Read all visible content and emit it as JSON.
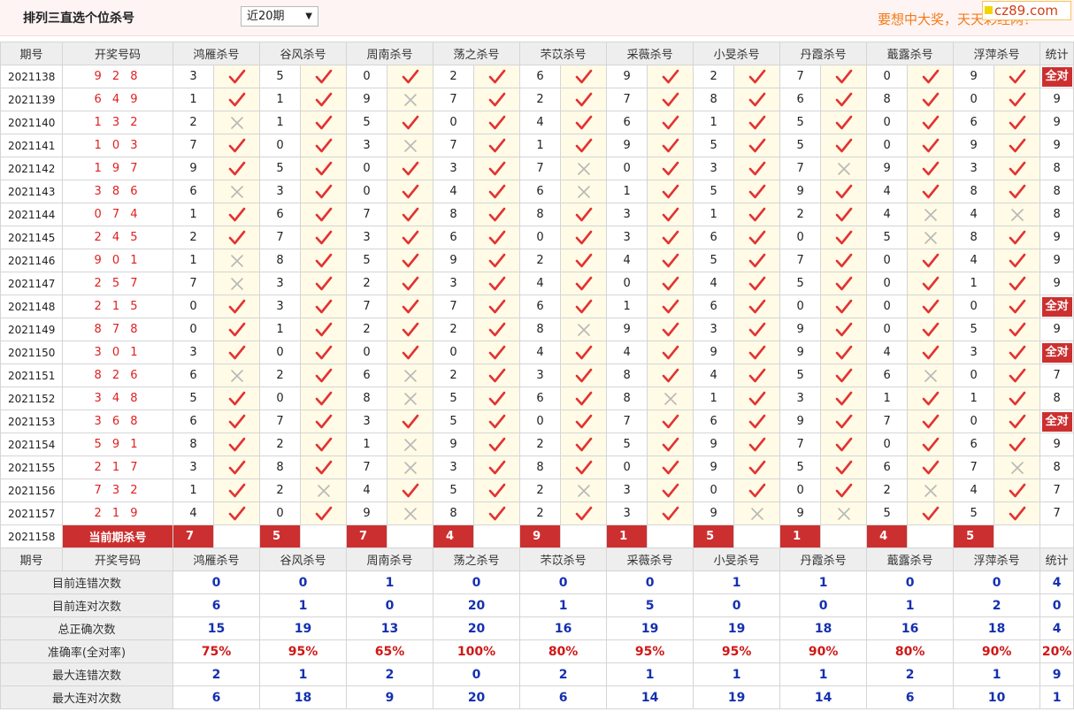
{
  "title": "排列三直选个位杀号",
  "period_selector": "近20期",
  "slogan": "要想中大奖，天天彩经网！",
  "logo": "cz89.com",
  "columns": {
    "period": "期号",
    "draw": "开奖号码",
    "experts": [
      "鸿雁杀号",
      "谷风杀号",
      "周南杀号",
      "荡之杀号",
      "芣苡杀号",
      "采薇杀号",
      "小旻杀号",
      "丹霞杀号",
      "蕺露杀号",
      "浮萍杀号"
    ],
    "stat": "统计"
  },
  "all_correct_label": "全对",
  "rows": [
    {
      "period": "2021138",
      "draw": "9 2 8",
      "kills": [
        [
          3,
          1
        ],
        [
          5,
          1
        ],
        [
          0,
          1
        ],
        [
          2,
          1
        ],
        [
          6,
          1
        ],
        [
          9,
          1
        ],
        [
          2,
          1
        ],
        [
          7,
          1
        ],
        [
          0,
          1
        ],
        [
          9,
          1
        ]
      ],
      "stat": "全对"
    },
    {
      "period": "2021139",
      "draw": "6 4 9",
      "kills": [
        [
          1,
          1
        ],
        [
          1,
          1
        ],
        [
          9,
          0
        ],
        [
          7,
          1
        ],
        [
          2,
          1
        ],
        [
          7,
          1
        ],
        [
          8,
          1
        ],
        [
          6,
          1
        ],
        [
          8,
          1
        ],
        [
          0,
          1
        ]
      ],
      "stat": "9"
    },
    {
      "period": "2021140",
      "draw": "1 3 2",
      "kills": [
        [
          2,
          0
        ],
        [
          1,
          1
        ],
        [
          5,
          1
        ],
        [
          0,
          1
        ],
        [
          4,
          1
        ],
        [
          6,
          1
        ],
        [
          1,
          1
        ],
        [
          5,
          1
        ],
        [
          0,
          1
        ],
        [
          6,
          1
        ]
      ],
      "stat": "9"
    },
    {
      "period": "2021141",
      "draw": "1 0 3",
      "kills": [
        [
          7,
          1
        ],
        [
          0,
          1
        ],
        [
          3,
          0
        ],
        [
          7,
          1
        ],
        [
          1,
          1
        ],
        [
          9,
          1
        ],
        [
          5,
          1
        ],
        [
          5,
          1
        ],
        [
          0,
          1
        ],
        [
          9,
          1
        ]
      ],
      "stat": "9"
    },
    {
      "period": "2021142",
      "draw": "1 9 7",
      "kills": [
        [
          9,
          1
        ],
        [
          5,
          1
        ],
        [
          0,
          1
        ],
        [
          3,
          1
        ],
        [
          7,
          0
        ],
        [
          0,
          1
        ],
        [
          3,
          1
        ],
        [
          7,
          0
        ],
        [
          9,
          1
        ],
        [
          3,
          1
        ]
      ],
      "stat": "8"
    },
    {
      "period": "2021143",
      "draw": "3 8 6",
      "kills": [
        [
          6,
          0
        ],
        [
          3,
          1
        ],
        [
          0,
          1
        ],
        [
          4,
          1
        ],
        [
          6,
          0
        ],
        [
          1,
          1
        ],
        [
          5,
          1
        ],
        [
          9,
          1
        ],
        [
          4,
          1
        ],
        [
          8,
          1
        ]
      ],
      "stat": "8"
    },
    {
      "period": "2021144",
      "draw": "0 7 4",
      "kills": [
        [
          1,
          1
        ],
        [
          6,
          1
        ],
        [
          7,
          1
        ],
        [
          8,
          1
        ],
        [
          8,
          1
        ],
        [
          3,
          1
        ],
        [
          1,
          1
        ],
        [
          2,
          1
        ],
        [
          4,
          0
        ],
        [
          4,
          0
        ]
      ],
      "stat": "8"
    },
    {
      "period": "2021145",
      "draw": "2 4 5",
      "kills": [
        [
          2,
          1
        ],
        [
          7,
          1
        ],
        [
          3,
          1
        ],
        [
          6,
          1
        ],
        [
          0,
          1
        ],
        [
          3,
          1
        ],
        [
          6,
          1
        ],
        [
          0,
          1
        ],
        [
          5,
          0
        ],
        [
          8,
          1
        ]
      ],
      "stat": "9"
    },
    {
      "period": "2021146",
      "draw": "9 0 1",
      "kills": [
        [
          1,
          0
        ],
        [
          8,
          1
        ],
        [
          5,
          1
        ],
        [
          9,
          1
        ],
        [
          2,
          1
        ],
        [
          4,
          1
        ],
        [
          5,
          1
        ],
        [
          7,
          1
        ],
        [
          0,
          1
        ],
        [
          4,
          1
        ]
      ],
      "stat": "9"
    },
    {
      "period": "2021147",
      "draw": "2 5 7",
      "kills": [
        [
          7,
          0
        ],
        [
          3,
          1
        ],
        [
          2,
          1
        ],
        [
          3,
          1
        ],
        [
          4,
          1
        ],
        [
          0,
          1
        ],
        [
          4,
          1
        ],
        [
          5,
          1
        ],
        [
          0,
          1
        ],
        [
          1,
          1
        ]
      ],
      "stat": "9"
    },
    {
      "period": "2021148",
      "draw": "2 1 5",
      "kills": [
        [
          0,
          1
        ],
        [
          3,
          1
        ],
        [
          7,
          1
        ],
        [
          7,
          1
        ],
        [
          6,
          1
        ],
        [
          1,
          1
        ],
        [
          6,
          1
        ],
        [
          0,
          1
        ],
        [
          0,
          1
        ],
        [
          0,
          1
        ]
      ],
      "stat": "全对"
    },
    {
      "period": "2021149",
      "draw": "8 7 8",
      "kills": [
        [
          0,
          1
        ],
        [
          1,
          1
        ],
        [
          2,
          1
        ],
        [
          2,
          1
        ],
        [
          8,
          0
        ],
        [
          9,
          1
        ],
        [
          3,
          1
        ],
        [
          9,
          1
        ],
        [
          0,
          1
        ],
        [
          5,
          1
        ]
      ],
      "stat": "9"
    },
    {
      "period": "2021150",
      "draw": "3 0 1",
      "kills": [
        [
          3,
          1
        ],
        [
          0,
          1
        ],
        [
          0,
          1
        ],
        [
          0,
          1
        ],
        [
          4,
          1
        ],
        [
          4,
          1
        ],
        [
          9,
          1
        ],
        [
          9,
          1
        ],
        [
          4,
          1
        ],
        [
          3,
          1
        ]
      ],
      "stat": "全对"
    },
    {
      "period": "2021151",
      "draw": "8 2 6",
      "kills": [
        [
          6,
          0
        ],
        [
          2,
          1
        ],
        [
          6,
          0
        ],
        [
          2,
          1
        ],
        [
          3,
          1
        ],
        [
          8,
          1
        ],
        [
          4,
          1
        ],
        [
          5,
          1
        ],
        [
          6,
          0
        ],
        [
          0,
          1
        ]
      ],
      "stat": "7"
    },
    {
      "period": "2021152",
      "draw": "3 4 8",
      "kills": [
        [
          5,
          1
        ],
        [
          0,
          1
        ],
        [
          8,
          0
        ],
        [
          5,
          1
        ],
        [
          6,
          1
        ],
        [
          8,
          0
        ],
        [
          1,
          1
        ],
        [
          3,
          1
        ],
        [
          1,
          1
        ],
        [
          1,
          1
        ]
      ],
      "stat": "8"
    },
    {
      "period": "2021153",
      "draw": "3 6 8",
      "kills": [
        [
          6,
          1
        ],
        [
          7,
          1
        ],
        [
          3,
          1
        ],
        [
          5,
          1
        ],
        [
          0,
          1
        ],
        [
          7,
          1
        ],
        [
          6,
          1
        ],
        [
          9,
          1
        ],
        [
          7,
          1
        ],
        [
          0,
          1
        ]
      ],
      "stat": "全对"
    },
    {
      "period": "2021154",
      "draw": "5 9 1",
      "kills": [
        [
          8,
          1
        ],
        [
          2,
          1
        ],
        [
          1,
          0
        ],
        [
          9,
          1
        ],
        [
          2,
          1
        ],
        [
          5,
          1
        ],
        [
          9,
          1
        ],
        [
          7,
          1
        ],
        [
          0,
          1
        ],
        [
          6,
          1
        ]
      ],
      "stat": "9"
    },
    {
      "period": "2021155",
      "draw": "2 1 7",
      "kills": [
        [
          3,
          1
        ],
        [
          8,
          1
        ],
        [
          7,
          0
        ],
        [
          3,
          1
        ],
        [
          8,
          1
        ],
        [
          0,
          1
        ],
        [
          9,
          1
        ],
        [
          5,
          1
        ],
        [
          6,
          1
        ],
        [
          7,
          0
        ]
      ],
      "stat": "8"
    },
    {
      "period": "2021156",
      "draw": "7 3 2",
      "kills": [
        [
          1,
          1
        ],
        [
          2,
          0
        ],
        [
          4,
          1
        ],
        [
          5,
          1
        ],
        [
          2,
          0
        ],
        [
          3,
          1
        ],
        [
          0,
          1
        ],
        [
          0,
          1
        ],
        [
          2,
          0
        ],
        [
          4,
          1
        ]
      ],
      "stat": "7"
    },
    {
      "period": "2021157",
      "draw": "2 1 9",
      "kills": [
        [
          4,
          1
        ],
        [
          0,
          1
        ],
        [
          9,
          0
        ],
        [
          8,
          1
        ],
        [
          2,
          1
        ],
        [
          3,
          1
        ],
        [
          9,
          0
        ],
        [
          9,
          0
        ],
        [
          5,
          1
        ],
        [
          5,
          1
        ]
      ],
      "stat": "7"
    }
  ],
  "current": {
    "period": "2021158",
    "label": "当前期杀号",
    "kills": [
      "7",
      "5",
      "7",
      "4",
      "9",
      "1",
      "5",
      "1",
      "4",
      "5"
    ]
  },
  "summary": [
    {
      "label": "目前连错次数",
      "values": [
        "0",
        "0",
        "1",
        "0",
        "0",
        "0",
        "1",
        "1",
        "0",
        "0"
      ],
      "stat": "4",
      "color": "blue"
    },
    {
      "label": "目前连对次数",
      "values": [
        "6",
        "1",
        "0",
        "20",
        "1",
        "5",
        "0",
        "0",
        "1",
        "2"
      ],
      "stat": "0",
      "color": "blue"
    },
    {
      "label": "总正确次数",
      "values": [
        "15",
        "19",
        "13",
        "20",
        "16",
        "19",
        "19",
        "18",
        "16",
        "18"
      ],
      "stat": "4",
      "color": "blue"
    },
    {
      "label": "准确率(全对率)",
      "values": [
        "75%",
        "95%",
        "65%",
        "100%",
        "80%",
        "95%",
        "95%",
        "90%",
        "80%",
        "90%"
      ],
      "stat": "20%",
      "color": "red"
    },
    {
      "label": "最大连错次数",
      "values": [
        "2",
        "1",
        "2",
        "0",
        "2",
        "1",
        "1",
        "1",
        "2",
        "1"
      ],
      "stat": "9",
      "color": "blue"
    },
    {
      "label": "最大连对次数",
      "values": [
        "6",
        "18",
        "9",
        "20",
        "6",
        "14",
        "19",
        "14",
        "6",
        "10"
      ],
      "stat": "1",
      "color": "blue"
    }
  ],
  "colors": {
    "check": "#e23333",
    "cross": "#b8b8b8",
    "badge": "#cc2f2f",
    "summary_blue": "#1530b0",
    "summary_red": "#d01818"
  },
  "icons": {
    "correct": "check-icon",
    "wrong": "cross-icon",
    "dropdown": "chevron-down-icon"
  }
}
